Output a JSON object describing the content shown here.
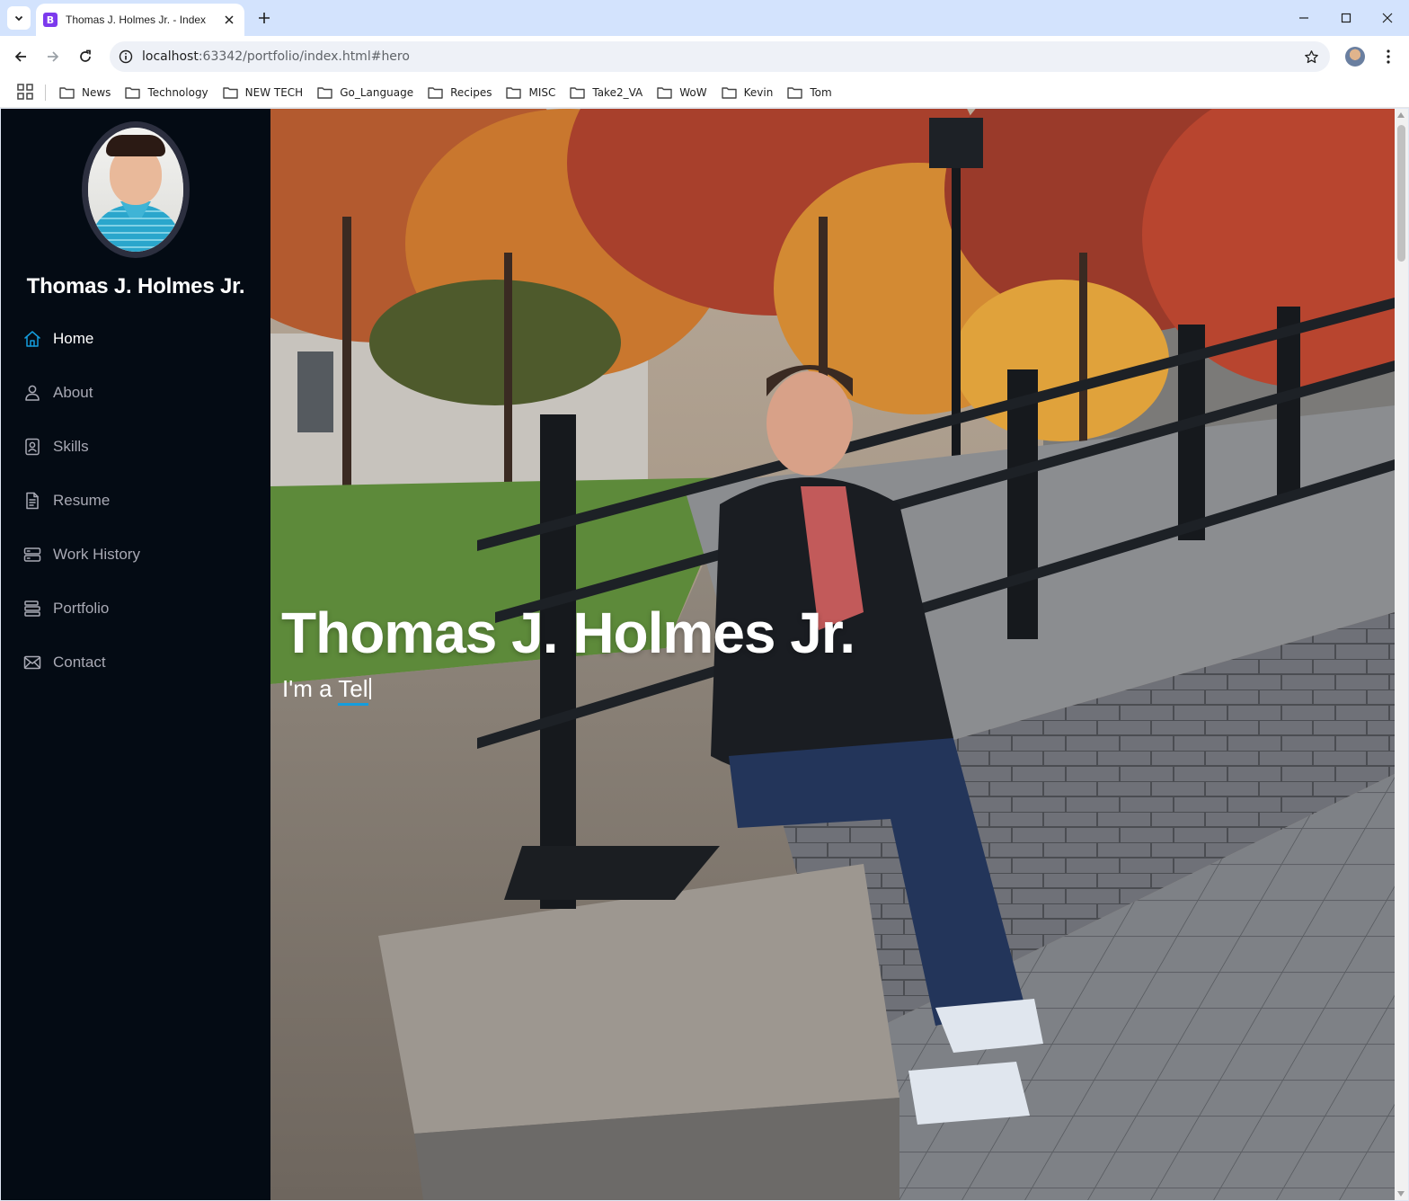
{
  "browser": {
    "tab": {
      "favicon_letter": "B",
      "favicon_color": "#7c3aed",
      "title": "Thomas J. Holmes Jr. - Index"
    },
    "url": {
      "host": "localhost",
      "rest": ":63342/portfolio/index.html#hero"
    },
    "bookmarks": [
      "News",
      "Technology",
      "NEW TECH",
      "Go_Language",
      "Recipes",
      "MISC",
      "Take2_VA",
      "WoW",
      "Kevin",
      "Tom"
    ]
  },
  "sidebar": {
    "name": "Thomas J. Holmes Jr.",
    "nav": [
      {
        "label": "Home",
        "icon": "house-icon",
        "active": true
      },
      {
        "label": "About",
        "icon": "person-icon",
        "active": false
      },
      {
        "label": "Skills",
        "icon": "file-person-icon",
        "active": false
      },
      {
        "label": "Resume",
        "icon": "file-text-icon",
        "active": false
      },
      {
        "label": "Work History",
        "icon": "server-icon",
        "active": false
      },
      {
        "label": "Portfolio",
        "icon": "stack-icon",
        "active": false
      },
      {
        "label": "Contact",
        "icon": "envelope-icon",
        "active": false
      }
    ]
  },
  "hero": {
    "title": "Thomas J. Holmes Jr.",
    "subtitle_prefix": "I'm a ",
    "typed_text": "Tel"
  },
  "colors": {
    "accent": "#149ddd",
    "sidebar_bg": "#040b14",
    "nav_text": "#a8a9b4",
    "tabstrip_bg": "#d3e3fd"
  }
}
